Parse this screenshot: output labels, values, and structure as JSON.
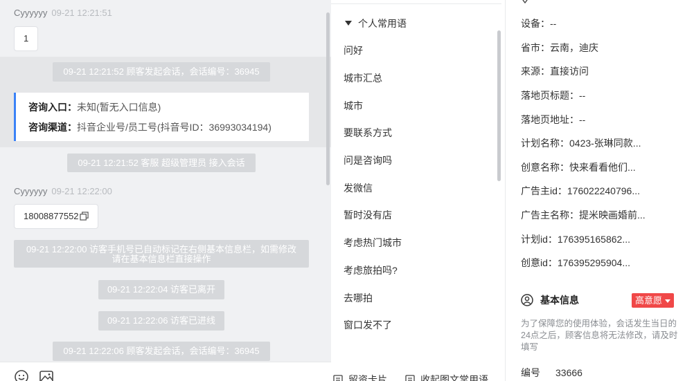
{
  "chat": {
    "messages": {
      "m1": {
        "sender": "Cyyyyyy",
        "time": "09-21 12:21:51",
        "text": "1"
      },
      "m2": {
        "sender": "Cyyyyyy",
        "time": "09-21 12:22:00",
        "text": "18008877552"
      }
    },
    "system": {
      "s1": "09-21 12:21:52 顾客发起会话，会话编号：36945",
      "s2": "09-21 12:21:52 客服 超级管理员 接入会话",
      "s3_line1": "09-21 12:22:00 访客手机号已自动标记在右侧基本信息栏，如需修改",
      "s3_line2": "请在基本信息栏直接操作",
      "s4": "09-21 12:22:04 访客已离开",
      "s5": "09-21 12:22:06 访客已进线",
      "s6": "09-21 12:22:06 顾客发起会话，会话编号：36945"
    },
    "entry_card": {
      "entry_label": "咨询入口：",
      "entry_value": "未知(暂无入口信息)",
      "channel_label": "咨询渠道：",
      "channel_value": "抖音企业号/员工号(抖音号ID：36993034194)"
    },
    "toolbar": {
      "emoji_icon": "emoji-icon",
      "image_icon": "image-icon"
    }
  },
  "phrases": {
    "group_title": "个人常用语",
    "items": [
      "问好",
      "城市汇总",
      "城市",
      "要联系方式",
      "问是咨询吗",
      "发微信",
      "暂时没有店",
      "考虑热门城市",
      "考虑旅拍吗?",
      "去哪拍",
      "窗口发不了"
    ],
    "footer": {
      "card_label": "留资卡片",
      "collapse_label": "收起图文常用语"
    }
  },
  "info": {
    "rows": [
      "设备：--",
      "省市：云南，迪庆",
      "来源：直接访问",
      "落地页标题：--",
      "落地页地址：--",
      "计划名称：0423-张琳同款...",
      "创意名称：快来看看他们...",
      "广告主id：176022240796...",
      "广告主名称：提米映画婚前...",
      "计划id：176395165862...",
      "创意id：176395295904..."
    ],
    "basic_title": "基本信息",
    "intent_badge": "高意愿",
    "notice": "为了保障您的使用体验，会话发生当日的24点之后，顾客信息将无法修改，请及时填写",
    "id_label": "编号",
    "id_value": "33666"
  },
  "colors": {
    "accent_blue": "#3a82f7",
    "badge_red": "#f04848",
    "system_msg_bg": "#d6d8db"
  }
}
